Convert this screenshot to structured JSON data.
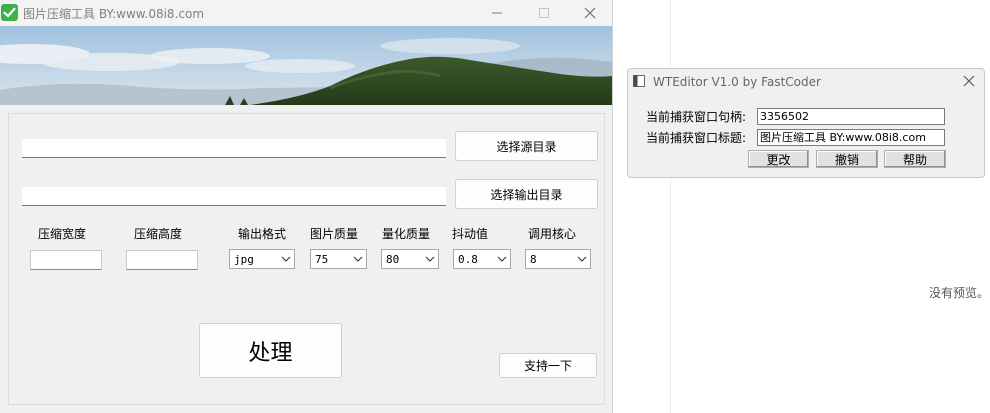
{
  "main_window": {
    "title": "图片压缩工具 BY:www.08i8.com",
    "source_dir_value": "",
    "output_dir_value": "",
    "select_source_button": "选择源目录",
    "select_output_button": "选择输出目录",
    "labels": {
      "width": "压缩宽度",
      "height": "压缩高度",
      "format": "输出格式",
      "quality": "图片质量",
      "quant": "量化质量",
      "dither": "抖动值",
      "cores": "调用核心"
    },
    "width_value": "",
    "height_value": "",
    "format_value": "jpg",
    "quality_value": "75",
    "quant_value": "80",
    "dither_value": "0.8",
    "cores_value": "8",
    "process_button": "处理",
    "support_button": "支持一下"
  },
  "wt_editor": {
    "title": "WTEditor V1.0 by FastCoder",
    "handle_label": "当前捕获窗口句柄:",
    "handle_value": "3356502",
    "window_title_label": "当前捕获窗口标题:",
    "window_title_value": "图片压缩工具 BY:www.08i8.com",
    "change_button": "更改",
    "undo_button": "撤销",
    "help_button": "帮助"
  },
  "preview": {
    "empty_text": "没有预览。"
  },
  "colors": {
    "app_icon_green": "#3fb14a",
    "window_bg": "#f0f0f0",
    "hill_green": "#2f4a22"
  }
}
